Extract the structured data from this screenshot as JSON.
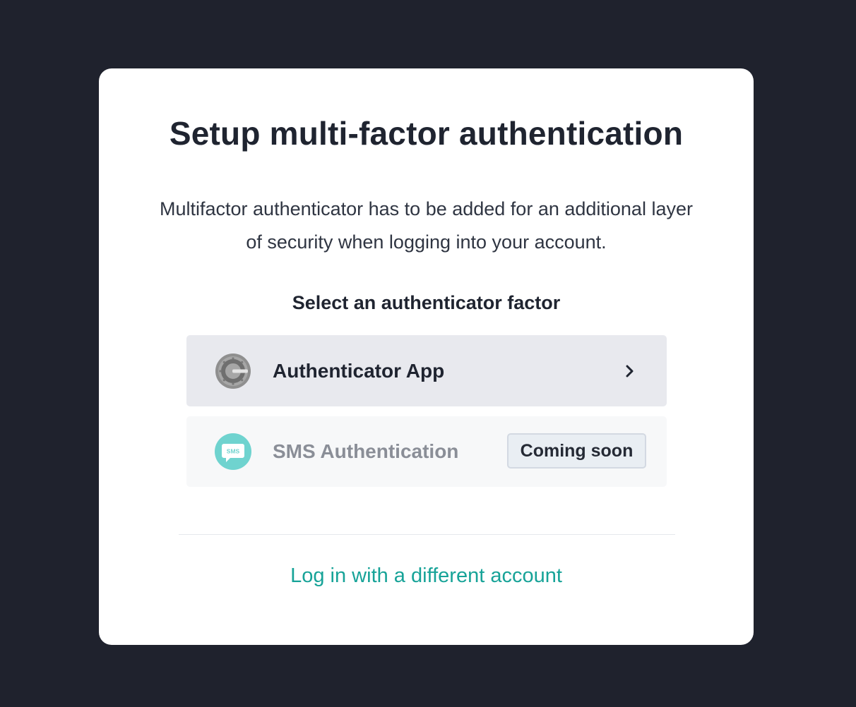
{
  "dialog": {
    "title": "Setup multi-factor authentication",
    "description": "Multifactor authenticator has to be added for an additional layer of security when logging into your account.",
    "section_label": "Select an authenticator factor"
  },
  "factors": [
    {
      "label": "Authenticator App",
      "icon": "google-authenticator-icon",
      "action_icon": "chevron-right-icon",
      "enabled": true
    },
    {
      "label": "SMS Authentication",
      "icon": "sms-icon",
      "icon_text": "SMS",
      "badge": "Coming soon",
      "enabled": false
    }
  ],
  "footer": {
    "alt_login_label": "Log in with a different account"
  },
  "colors": {
    "background": "#1f222d",
    "card": "#ffffff",
    "accent_link": "#17a398",
    "sms_icon": "#6fd3cf",
    "selected_row": "#e8e9ee"
  }
}
